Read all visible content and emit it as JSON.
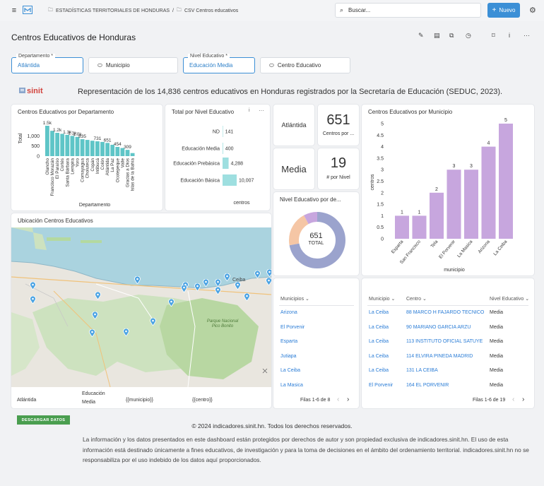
{
  "breadcrumb": {
    "root": "ESTADÍSTICAS TERRITORIALES DE HONDURAS",
    "sep": "/",
    "current": "CSV Centros educativos"
  },
  "search": {
    "placeholder": "Buscar..."
  },
  "new_button": "Nuevo",
  "page_title": "Centros Educativos de Honduras",
  "filters": [
    {
      "label": "Departamento *",
      "value": "Atlántida"
    },
    {
      "label": "",
      "value": "Municipio"
    },
    {
      "label": "Nivel Educativo *",
      "value": "Educación Media"
    },
    {
      "label": "",
      "value": "Centro Educativo"
    }
  ],
  "banner": {
    "logo": "sinit",
    "text": "Representación de los 14,836 centros educativos en Honduras registrados por la Secretaría de Educación (SEDUC, 2023)."
  },
  "dept_chart": {
    "title": "Centros Educativos por Departamento",
    "ylabel": "Total",
    "xlabel": "Departamento",
    "yticks": [
      "1,000",
      "500",
      "0"
    ],
    "bar_labels": [
      "1.5k",
      "1.2k",
      "1.1k",
      "1.1k",
      "1.0k",
      "835",
      "731",
      "651",
      "454",
      "309"
    ]
  },
  "nivel_table": {
    "title": "Total por Nivel Educativo",
    "xlabel": "centros"
  },
  "kpi": {
    "dept_name": "Atlántida",
    "centers": "651",
    "centers_label": "Centros por ...",
    "level_name": "Media",
    "per_level": "19",
    "per_level_label": "# por Nivel"
  },
  "donut": {
    "title": "Nivel Educativo por de...",
    "value": "651",
    "label": "TOTAL"
  },
  "muni_chart": {
    "title": "Centros Educativos por Municipio",
    "ylabel": "centros",
    "xlabel": "municipio",
    "yticks": [
      "5",
      "4.5",
      "4",
      "3.5",
      "3",
      "2.5",
      "2",
      "1.5",
      "1",
      "0.5",
      "0"
    ]
  },
  "map": {
    "title": "Ubicación Centros Educativos",
    "place1": "Ceiba",
    "park": "Parque Nacional Pico Bonito"
  },
  "map_footer": {
    "c1": "Atlántida",
    "c2": "Educación Media",
    "c3": "{{municipio}}",
    "c4": "{{centro}}"
  },
  "muni_list": {
    "header": "Municipios",
    "items": [
      "Arizona",
      "El Porvenir",
      "Esparta",
      "Jutiapa",
      "La Ceiba",
      "La Masica"
    ],
    "pager": "Filas 1-6 de 8"
  },
  "centers_table": {
    "headers": [
      "Municipio",
      "Centro",
      "Nivel Educativo"
    ],
    "rows": [
      [
        "La Ceiba",
        "88 MARCO H FAJARDO TECNICO",
        "Media"
      ],
      [
        "La Ceiba",
        "90 MARIANO GARCIA ARZU",
        "Media"
      ],
      [
        "La Ceiba",
        "113 INSTITUTO OFICIAL SATUYE",
        "Media"
      ],
      [
        "La Ceiba",
        "114 ELVIRA PINEDA MADRID",
        "Media"
      ],
      [
        "La Ceiba",
        "131 LA CEIBA",
        "Media"
      ],
      [
        "El Porvenir",
        "164 EL PORVENIR",
        "Media"
      ]
    ],
    "pager": "Filas 1-6 de 19"
  },
  "download_button": "DESCARGAR DATOS",
  "footer": {
    "copyright": "© 2024 indicadores.sinit.hn. Todos los derechos reservados.",
    "disclaimer": "La información y los datos presentados en este dashboard están protegidos por derechos de autor y son propiedad exclusiva de indicadores.sinit.hn. El uso de esta información está destinado únicamente a fines educativos, de investigación y para la toma de decisiones en el ámbito del ordenamiento territorial. indicadores.sinit.hn no se responsabiliza por el uso indebido de los datos aquí proporcionados."
  },
  "colors": {
    "teal": "#5ec5c7",
    "teal_light": "#9edfe0",
    "purple": "#c7a6de",
    "donut_main": "#9ba3cd",
    "donut_b": "#f5c6a5",
    "donut_c": "#c7a6de",
    "accent": "#3b8fd6",
    "green": "#4a9e4f"
  },
  "chart_data": [
    {
      "type": "bar",
      "title": "Centros Educativos por Departamento",
      "xlabel": "Departamento",
      "ylabel": "Total",
      "categories": [
        "Olancho",
        "Francisco Morazán",
        "El Paraíso",
        "Cortés",
        "Santa Bárbara",
        "Lempira",
        "Yoro",
        "Comayagua",
        "Choluteca",
        "Copán",
        "Intibucá",
        "Colón",
        "Atlántida",
        "La Paz",
        "Ocotepeque",
        "Valle",
        "Gracias a Dios",
        "Islas de la Bahía"
      ],
      "values": [
        1500,
        1250,
        1150,
        1100,
        1050,
        1000,
        950,
        835,
        800,
        760,
        731,
        700,
        651,
        560,
        454,
        400,
        309,
        150
      ],
      "bar_labels": {
        "0": "1.5k",
        "2": "1.2k",
        "4": "1.1k",
        "5": "1.1k",
        "6": "1.0k",
        "7": "835",
        "10": "731",
        "12": "651",
        "14": "454",
        "16": "309"
      },
      "ylim": [
        0,
        1500
      ]
    },
    {
      "type": "bar",
      "title": "Total por Nivel Educativo",
      "xlabel": "centros",
      "categories": [
        "ND",
        "Educación Media",
        "Educación Prebásica",
        "Educación Básica"
      ],
      "values": [
        141,
        400,
        4288,
        10007
      ],
      "value_labels": [
        "141",
        "400",
        "4,288",
        "10,007"
      ]
    },
    {
      "type": "pie",
      "title": "Nivel Educativo por de...",
      "total": 651,
      "slices": [
        {
          "fraction": 0.72
        },
        {
          "fraction": 0.2
        },
        {
          "fraction": 0.08
        }
      ]
    },
    {
      "type": "bar",
      "title": "Centros Educativos por Municipio",
      "xlabel": "municipio",
      "ylabel": "centros",
      "categories": [
        "Esparta",
        "San Francisco",
        "Tela",
        "El Porvenir",
        "La Masica",
        "Arizona",
        "La Ceiba"
      ],
      "values": [
        1,
        1,
        2,
        3,
        3,
        4,
        5
      ],
      "ylim": [
        0,
        5
      ]
    }
  ]
}
